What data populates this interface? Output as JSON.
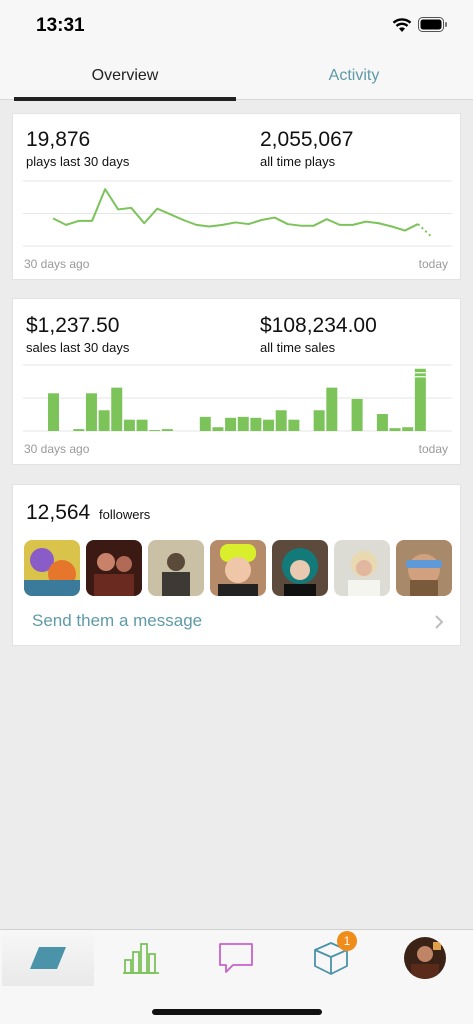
{
  "status_bar": {
    "time": "13:31"
  },
  "tabs": [
    {
      "label": "Overview",
      "active": true
    },
    {
      "label": "Activity",
      "active": false
    }
  ],
  "plays_card": {
    "stat_left": {
      "value": "19,876",
      "label": "plays last 30 days"
    },
    "stat_right": {
      "value": "2,055,067",
      "label": "all time plays"
    },
    "axis_start": "30 days ago",
    "axis_end": "today"
  },
  "sales_card": {
    "stat_left": {
      "value": "$1,237.50",
      "label": "sales last 30 days"
    },
    "stat_right": {
      "value": "$108,234.00",
      "label": "all time sales"
    },
    "axis_start": "30 days ago",
    "axis_end": "today"
  },
  "followers_card": {
    "count": "12,564",
    "label": "followers",
    "message_link": "Send them a message",
    "avatar_count": 7
  },
  "tab_bar": {
    "items": [
      "home-icon",
      "stats-icon",
      "messages-icon",
      "orders-icon",
      "profile-avatar"
    ],
    "orders_badge": "1"
  },
  "chart_data": [
    {
      "type": "line",
      "x": [
        1,
        2,
        3,
        4,
        5,
        6,
        7,
        8,
        9,
        10,
        11,
        12,
        13,
        14,
        15,
        16,
        17,
        18,
        19,
        20,
        21,
        22,
        23,
        24,
        25,
        26,
        27,
        28,
        29,
        30
      ],
      "values": [
        640,
        560,
        610,
        610,
        1000,
        750,
        770,
        580,
        760,
        690,
        620,
        560,
        540,
        560,
        590,
        570,
        620,
        650,
        570,
        550,
        550,
        630,
        560,
        560,
        600,
        580,
        540,
        490,
        570,
        420
      ],
      "color": "#7cc35a",
      "xlabel_start": "30 days ago",
      "xlabel_end": "today"
    },
    {
      "type": "bar",
      "x": [
        1,
        2,
        3,
        4,
        5,
        6,
        7,
        8,
        9,
        10,
        11,
        12,
        13,
        14,
        15,
        16,
        17,
        18,
        19,
        20,
        21,
        22,
        23,
        24,
        25,
        26,
        27,
        28,
        29,
        30
      ],
      "values": [
        40,
        0,
        2,
        40,
        22,
        46,
        12,
        12,
        1,
        2,
        0,
        0,
        15,
        4,
        14,
        15,
        14,
        12,
        22,
        12,
        0,
        22,
        46,
        0,
        34,
        0,
        18,
        3,
        4,
        66
      ],
      "color": "#7cc35a",
      "xlabel_start": "30 days ago",
      "xlabel_end": "today"
    }
  ]
}
